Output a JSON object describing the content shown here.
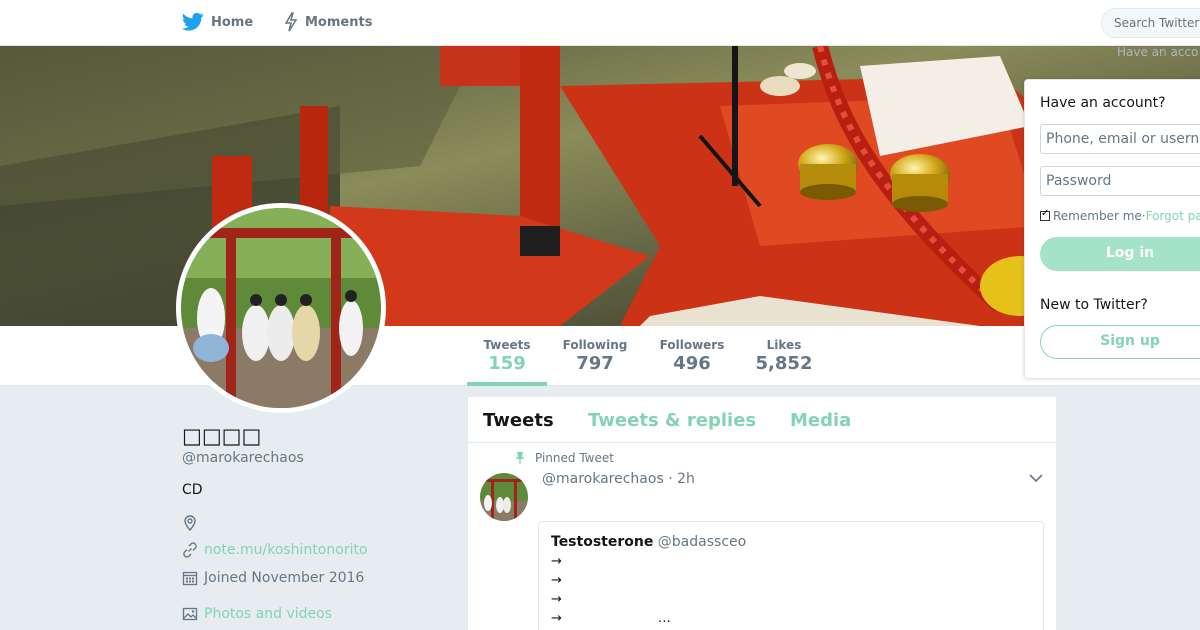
{
  "nav": {
    "home_label": "Home",
    "moments_label": "Moments",
    "search_placeholder": "Search Twitter",
    "have_account_hint": "Have an acco"
  },
  "stats": [
    {
      "label": "Tweets",
      "value": "159"
    },
    {
      "label": "Following",
      "value": "797"
    },
    {
      "label": "Followers",
      "value": "496"
    },
    {
      "label": "Likes",
      "value": "5,852"
    }
  ],
  "profile": {
    "name": "□□□□",
    "handle": "@marokarechaos",
    "bio": "CD",
    "link": "note.mu/koshintonorito",
    "joined": "Joined November 2016",
    "photos_label": "Photos and videos"
  },
  "timeline": {
    "tabs": [
      "Tweets",
      "Tweets & replies",
      "Media"
    ],
    "pinned_label": "Pinned Tweet",
    "tweet": {
      "header": "@marokarechaos · 2h",
      "quote": {
        "name": "Testosterone",
        "handle": "@badassceo",
        "lines": [
          "→",
          "→",
          "→",
          "→"
        ],
        "ellipsis": "…"
      }
    }
  },
  "login": {
    "title": "Have an account?",
    "username_placeholder": "Phone, email or username",
    "password_placeholder": "Password",
    "remember_label": "Remember me",
    "separator": " · ",
    "forgot_label": "Forgot password?",
    "login_button": "Log in",
    "new_to_label": "New to Twitter?",
    "signup_button": "Sign up"
  },
  "colors": {
    "accent": "#83d3b4",
    "twitter_blue": "#1da1f2",
    "background": "#e6ecf0"
  }
}
